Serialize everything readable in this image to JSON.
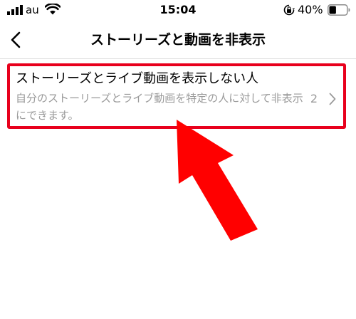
{
  "status_bar": {
    "carrier": "au",
    "time": "15:04",
    "battery_percent": "40%",
    "battery_level": 0.4,
    "icons": [
      "signal-bars-icon",
      "wifi-icon",
      "orientation-lock-icon",
      "battery-icon"
    ]
  },
  "header": {
    "title": "ストーリーズと動画を非表示",
    "back_icon": "chevron-left-icon"
  },
  "row": {
    "title": "ストーリーズとライブ動画を表示しない人",
    "subtitle": "自分のストーリーズとライブ動画を特定の人に対して非表示にできます。",
    "count": "2",
    "chevron_icon": "chevron-right-icon"
  },
  "annotation": {
    "highlight_color": "#e8001c",
    "arrow_color": "#ff0000"
  }
}
